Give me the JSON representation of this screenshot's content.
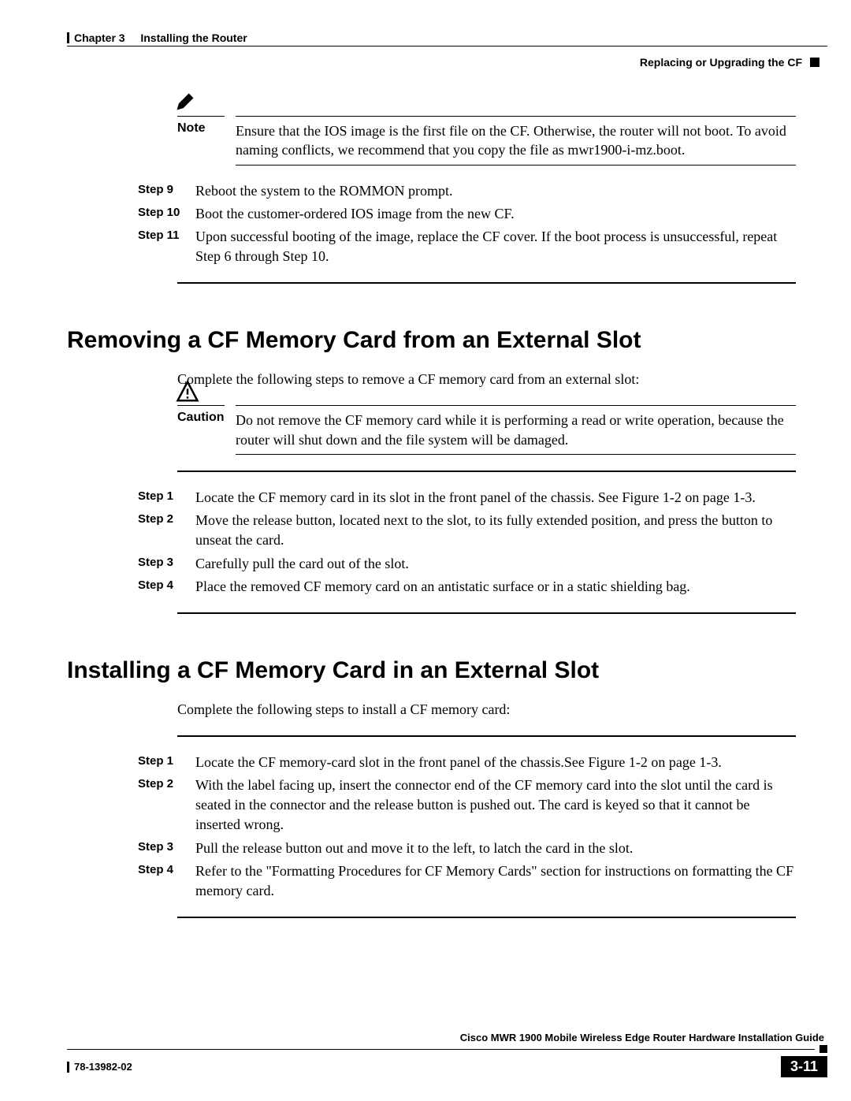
{
  "header": {
    "chapter": "Chapter 3",
    "chapter_title": "Installing the Router",
    "section": "Replacing or Upgrading the CF"
  },
  "note": {
    "label": "Note",
    "text": "Ensure that the IOS image is the first file on the CF. Otherwise, the router will not boot. To avoid naming conflicts, we recommend that you copy the file as mwr1900-i-mz.boot."
  },
  "steps_top": [
    {
      "label": "Step 9",
      "text": "Reboot the system to the ROMMON prompt."
    },
    {
      "label": "Step 10",
      "text": "Boot the customer-ordered IOS image from the new CF."
    },
    {
      "label": "Step 11",
      "text": "Upon successful booting of the image, replace the CF cover. If the boot process is unsuccessful, repeat Step 6 through Step 10."
    }
  ],
  "section_remove": {
    "title": "Removing a CF Memory Card from an External Slot",
    "intro": "Complete the following steps to remove a CF memory card from an external slot:"
  },
  "caution": {
    "label": "Caution",
    "text": "Do not remove the CF memory card while it is performing a read or write operation, because the router will shut down and the file system will be damaged."
  },
  "steps_remove": [
    {
      "label": "Step 1",
      "text": "Locate the CF memory card in its slot in the front panel of the chassis. See Figure 1-2 on page 1-3."
    },
    {
      "label": "Step 2",
      "text": "Move the release button, located next to the slot, to its fully extended position, and press the button to unseat the card."
    },
    {
      "label": "Step 3",
      "text": "Carefully pull the card out of the slot."
    },
    {
      "label": "Step 4",
      "text": "Place the removed CF memory card on an antistatic surface or in a static shielding bag."
    }
  ],
  "section_install": {
    "title": "Installing a CF Memory Card in an External Slot",
    "intro": "Complete the following steps to install a CF memory card:"
  },
  "steps_install": [
    {
      "label": "Step 1",
      "text": "Locate the CF memory-card slot in the front panel of the chassis.See Figure 1-2 on page 1-3."
    },
    {
      "label": "Step 2",
      "text": "With the label facing up, insert the connector end of the CF memory card into the slot until the card is seated in the connector and the release button is pushed out. The card is keyed so that it cannot be inserted wrong."
    },
    {
      "label": "Step 3",
      "text": "Pull the release button out and move it to the left, to latch the card in the slot."
    },
    {
      "label": "Step 4",
      "text": "Refer to the \"Formatting Procedures for CF Memory Cards\" section for instructions on formatting the CF memory card."
    }
  ],
  "footer": {
    "guide": "Cisco MWR 1900 Mobile Wireless Edge Router Hardware Installation Guide",
    "doc": "78-13982-02",
    "page": "3-11"
  }
}
